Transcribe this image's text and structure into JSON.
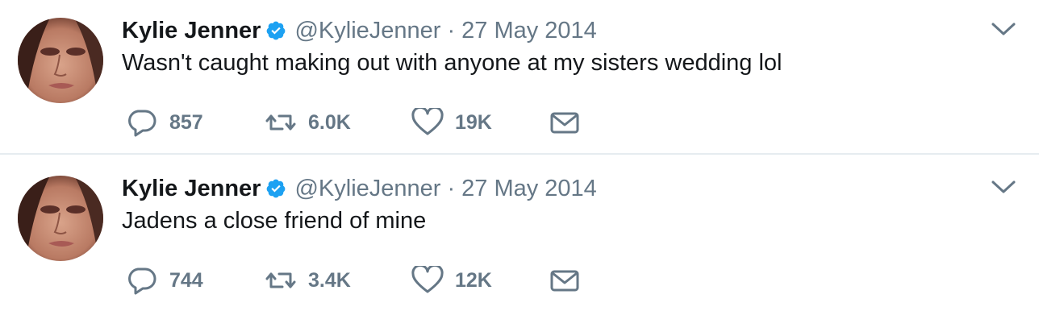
{
  "colors": {
    "text_primary": "#14171a",
    "text_secondary": "#657786",
    "verified_blue": "#1da1f2",
    "divider": "#e6ecf0"
  },
  "tweets": [
    {
      "author": {
        "name": "Kylie Jenner",
        "handle": "@KylieJenner",
        "verified": true
      },
      "separator": "·",
      "date": "27 May 2014",
      "text": "Wasn't caught making out with anyone at my sisters wedding lol",
      "stats": {
        "replies": "857",
        "retweets": "6.0K",
        "likes": "19K"
      },
      "icons": {
        "reply": "reply-icon",
        "retweet": "retweet-icon",
        "like": "heart-icon",
        "dm": "envelope-icon",
        "more": "chevron-down-icon"
      }
    },
    {
      "author": {
        "name": "Kylie Jenner",
        "handle": "@KylieJenner",
        "verified": true
      },
      "separator": "·",
      "date": "27 May 2014",
      "text": "Jadens a close friend of mine",
      "stats": {
        "replies": "744",
        "retweets": "3.4K",
        "likes": "12K"
      },
      "icons": {
        "reply": "reply-icon",
        "retweet": "retweet-icon",
        "like": "heart-icon",
        "dm": "envelope-icon",
        "more": "chevron-down-icon"
      }
    }
  ]
}
